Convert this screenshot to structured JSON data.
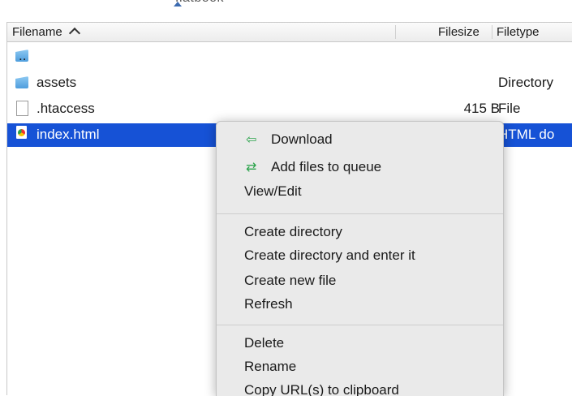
{
  "top_clipped_text": "flatbook",
  "columns": {
    "filename": "Filename",
    "filesize": "Filesize",
    "filetype": "Filetype"
  },
  "rows": [
    {
      "name": "..",
      "size": "",
      "type": ""
    },
    {
      "name": "assets",
      "size": "",
      "type": "Directory"
    },
    {
      "name": ".htaccess",
      "size": "415 B",
      "type": "File"
    },
    {
      "name": "index.html",
      "size": "",
      "type": "HTML do"
    }
  ],
  "menu": {
    "download": "Download",
    "add_to_queue": "Add files to queue",
    "view_edit": "View/Edit",
    "create_directory": "Create directory",
    "create_directory_enter": "Create directory and enter it",
    "create_new_file": "Create new file",
    "refresh": "Refresh",
    "delete": "Delete",
    "rename": "Rename",
    "copy_urls": "Copy URL(s) to clipboard"
  },
  "colors": {
    "selection": "#1652d6",
    "download_arrow": "#2aa34a",
    "queue_icon": "#2aa34a"
  }
}
